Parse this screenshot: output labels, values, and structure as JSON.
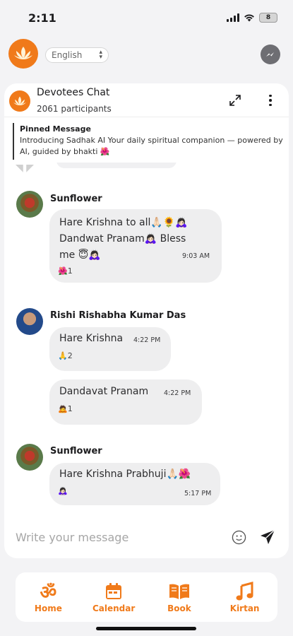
{
  "status_bar": {
    "time": "2:11",
    "battery": "8"
  },
  "header": {
    "language": "English"
  },
  "chat": {
    "title": "Devotees Chat",
    "participants": "2061 participants",
    "pinned": {
      "title": "Pinned Message",
      "text": "Introducing Sadhak AI Your daily spiritual companion — powered by AI, guided by bhakti 🌺"
    },
    "messages": [
      {
        "sender": "Sunflower",
        "lines": [
          "Hare Krishna to all🙏🏻🌻🙇🏻‍♀️",
          "Dandwat Pranam🙇🏻‍♀️ Bless",
          "me 😇🙇🏻‍♀️"
        ],
        "time": "9:03 AM",
        "reaction": "🌺",
        "reaction_count": "1"
      },
      {
        "sender": "Rishi Rishabha Kumar Das",
        "text": "Hare Krishna",
        "time": "4:22 PM",
        "reaction": "🙏",
        "reaction_count": "2"
      },
      {
        "text": "Dandavat Pranam",
        "time": "4:22 PM",
        "reaction": "🙇",
        "reaction_count": "1"
      },
      {
        "sender": "Sunflower",
        "text": "Hare Krishna Prabhuji🙏🏻🌺",
        "time": "5:17 PM",
        "reaction": "🙇🏻‍♀️"
      }
    ],
    "input_placeholder": "Write your message"
  },
  "nav": {
    "items": [
      {
        "label": "Home",
        "icon": "om-icon"
      },
      {
        "label": "Calendar",
        "icon": "calendar-icon"
      },
      {
        "label": "Book",
        "icon": "book-icon"
      },
      {
        "label": "Kirtan",
        "icon": "music-note-icon"
      }
    ]
  },
  "colors": {
    "accent": "#f07a1a",
    "bubble": "#eeeeef",
    "background": "#f3f3f5"
  }
}
